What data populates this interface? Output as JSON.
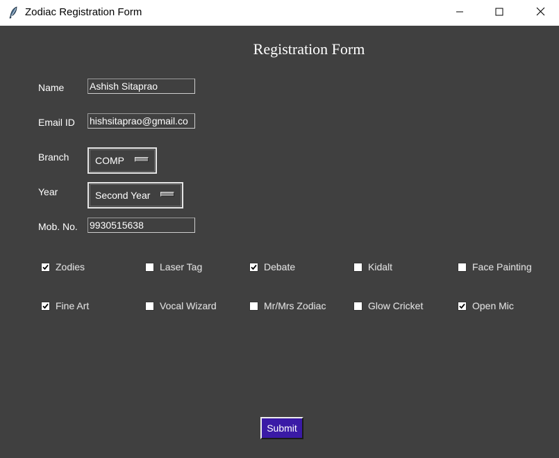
{
  "window": {
    "title": "Zodiac Registration Form",
    "icon": "feather-icon",
    "controls": [
      "minimize-icon",
      "maximize-icon",
      "close-icon"
    ]
  },
  "form": {
    "title": "Registration Form",
    "fields": {
      "name": {
        "label": "Name",
        "value": "Ashish Sitaprao"
      },
      "email": {
        "label": "Email ID",
        "value": "hishsitaprao@gmail.co"
      },
      "branch": {
        "label": "Branch",
        "value": "COMP"
      },
      "year": {
        "label": "Year",
        "value": "Second Year"
      },
      "mobile": {
        "label": "Mob. No.",
        "value": "9930515638"
      }
    },
    "events": [
      {
        "label": "Zodies",
        "checked": true
      },
      {
        "label": "Laser Tag",
        "checked": false
      },
      {
        "label": "Debate",
        "checked": true
      },
      {
        "label": "Kidalt",
        "checked": false
      },
      {
        "label": "Face Painting",
        "checked": false
      },
      {
        "label": "Fine Art",
        "checked": true
      },
      {
        "label": "Vocal Wizard",
        "checked": false
      },
      {
        "label": "Mr/Mrs Zodiac",
        "checked": false
      },
      {
        "label": "Glow Cricket",
        "checked": false
      },
      {
        "label": "Open Mic",
        "checked": true
      }
    ],
    "submit_label": "Submit"
  },
  "colors": {
    "background": "#404040",
    "submit_button": "#3a1aa6",
    "text": "#ffffff"
  }
}
